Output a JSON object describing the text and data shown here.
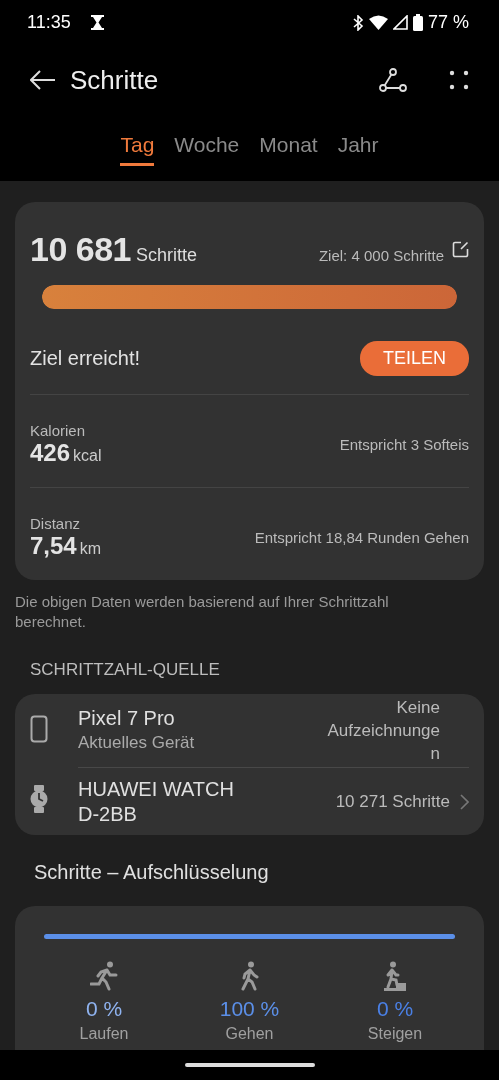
{
  "status_bar": {
    "time": "11:35",
    "battery": "77 %"
  },
  "app_bar": {
    "title": "Schritte"
  },
  "tabs": [
    {
      "label": "Tag",
      "selected": true
    },
    {
      "label": "Woche",
      "selected": false
    },
    {
      "label": "Monat",
      "selected": false
    },
    {
      "label": "Jahr",
      "selected": false
    }
  ],
  "summary": {
    "steps": "10 681",
    "steps_unit": "Schritte",
    "goal": "Ziel: 4 000 Schritte",
    "level": 1,
    "goal_status": "Ziel erreicht!",
    "share_button": "TEILEN",
    "metrics": [
      {
        "label": "Kalorien",
        "value": "426",
        "unit": "kcal",
        "comparison": "Entspricht 3 Softeis"
      },
      {
        "label": "Distanz",
        "value": "7,54",
        "unit": "km",
        "comparison": "Entspricht 18,84 Runden Gehen"
      }
    ]
  },
  "note": "Die obigen Daten werden basierend auf Ihrer Schrittzahl berechnet.",
  "source_section": {
    "title": "SCHRITTZAHL-QUELLE",
    "devices": [
      {
        "kind": "phone",
        "name": "Pixel 7 Pro",
        "subtitle": "Aktuelles Gerät",
        "value": "Keine Aufzeichnungen",
        "chevron": false
      },
      {
        "kind": "watch",
        "name": "HUAWEI WATCH D-2BB",
        "value": "10 271 Schritte",
        "chevron": true
      }
    ]
  },
  "breakdown": {
    "title": "Schritte – Aufschlüsselung",
    "items": [
      {
        "kind": "run",
        "percent": "0 %",
        "label": "Laufen",
        "color": "#8fb3f0"
      },
      {
        "kind": "walk",
        "percent": "100 %",
        "label": "Gehen",
        "color": "#5b8fe8"
      },
      {
        "kind": "climb",
        "percent": "0 %",
        "label": "Steigen",
        "color": "#4a80e6"
      }
    ]
  }
}
